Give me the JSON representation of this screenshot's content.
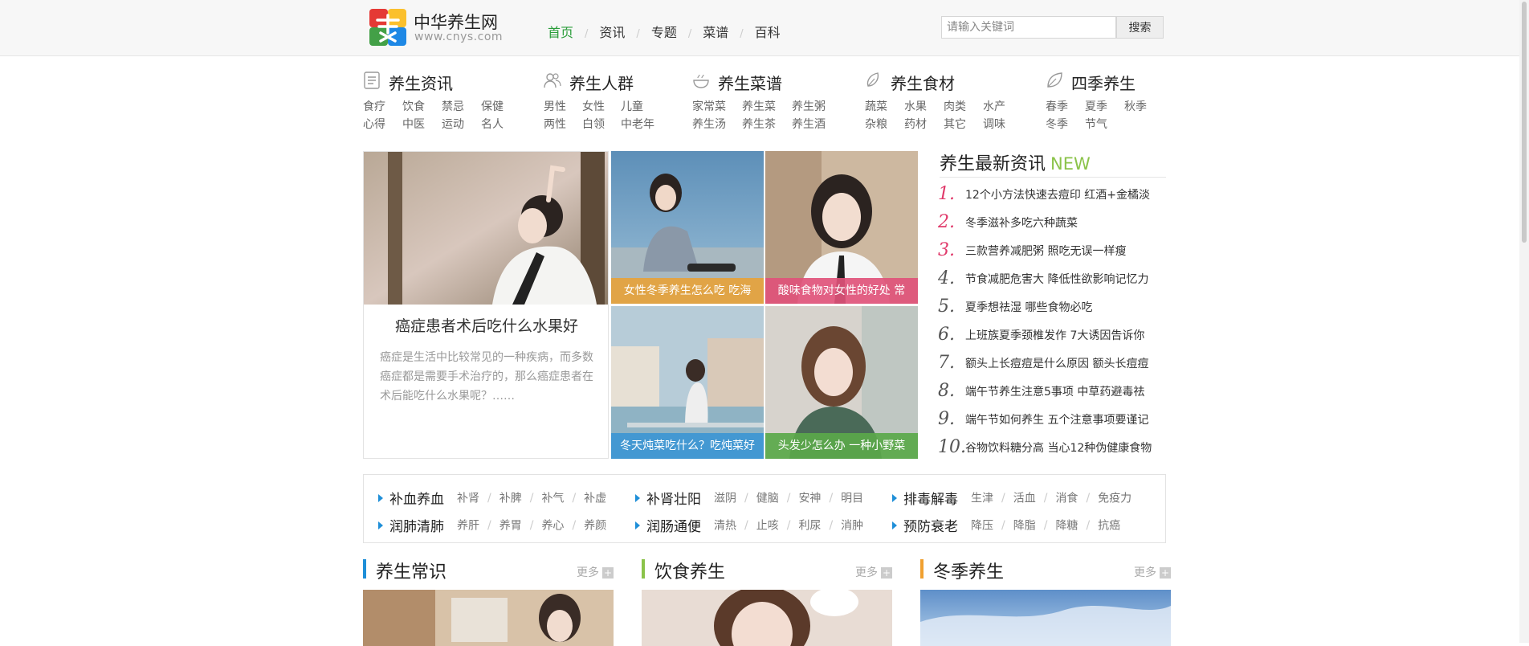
{
  "header": {
    "site_name": "中华养生网",
    "site_url": "www.cnys.com",
    "nav": [
      "首页",
      "资讯",
      "专题",
      "菜谱",
      "百科"
    ],
    "nav_sep": "/",
    "search": {
      "placeholder": "请输入关键词",
      "button": "搜索"
    }
  },
  "categories": [
    {
      "title": "养生资讯",
      "icon": "document-icon",
      "rows": [
        [
          "食疗",
          "饮食",
          "禁忌",
          "保健"
        ],
        [
          "心得",
          "中医",
          "运动",
          "名人"
        ]
      ]
    },
    {
      "title": "养生人群",
      "icon": "people-icon",
      "rows": [
        [
          "男性",
          "女性",
          "儿童"
        ],
        [
          "两性",
          "白领",
          "中老年"
        ]
      ]
    },
    {
      "title": "养生菜谱",
      "icon": "bowl-icon",
      "rows": [
        [
          "家常菜",
          "养生菜",
          "养生粥"
        ],
        [
          "养生汤",
          "养生茶",
          "养生酒"
        ]
      ]
    },
    {
      "title": "养生食材",
      "icon": "vegetable-icon",
      "rows": [
        [
          "蔬菜",
          "水果",
          "肉类",
          "水产"
        ],
        [
          "杂粮",
          "药材",
          "其它",
          "调味"
        ]
      ]
    },
    {
      "title": "四季养生",
      "icon": "leaf-icon",
      "rows": [
        [
          "春季",
          "夏季",
          "秋季"
        ],
        [
          "冬季",
          "节气"
        ]
      ]
    }
  ],
  "feature": {
    "title": "癌症患者术后吃什么水果好",
    "desc": "癌症是生活中比较常见的一种疾病，而多数癌症都是需要手术治疗的，那么癌症患者在术后能吃什么水果呢？……"
  },
  "tiles": [
    {
      "caption": "女性冬季养生怎么吃 吃海",
      "color": "#e6a23c"
    },
    {
      "caption": "酸味食物对女性的好处 常",
      "color": "#e0527a"
    },
    {
      "caption": "冬天炖菜吃什么？吃炖菜好",
      "color": "#3d96d3"
    },
    {
      "caption": "头发少怎么办 一种小野菜",
      "color": "#5aa84a"
    }
  ],
  "news": {
    "title": "养生最新资讯",
    "badge": "NEW",
    "items": [
      {
        "num": "1.",
        "text": "12个小方法快速去痘印 红酒+金橘淡"
      },
      {
        "num": "2.",
        "text": "冬季滋补多吃六种蔬菜"
      },
      {
        "num": "3.",
        "text": "三款营养减肥粥 照吃无误一样瘦"
      },
      {
        "num": "4.",
        "text": "节食减肥危害大 降低性欲影响记忆力"
      },
      {
        "num": "5.",
        "text": "夏季想祛湿 哪些食物必吃"
      },
      {
        "num": "6.",
        "text": "上班族夏季颈椎发作 7大诱因告诉你"
      },
      {
        "num": "7.",
        "text": "额头上长痘痘是什么原因 额头长痘痘"
      },
      {
        "num": "8.",
        "text": "端午节养生注意5事项 中草药避毒祛"
      },
      {
        "num": "9.",
        "text": "端午节如何养生 五个注意事项要谨记"
      },
      {
        "num": "10.",
        "text": "谷物饮料糖分高 当心12种伪健康食物"
      }
    ]
  },
  "tags": [
    {
      "name": "补血养血",
      "links": [
        "补肾",
        "补脾",
        "补气",
        "补虚"
      ]
    },
    {
      "name": "补肾壮阳",
      "links": [
        "滋阴",
        "健脑",
        "安神",
        "明目"
      ]
    },
    {
      "name": "排毒解毒",
      "links": [
        "生津",
        "活血",
        "消食",
        "免疫力"
      ]
    },
    {
      "name": "润肺清肺",
      "links": [
        "养肝",
        "养胃",
        "养心",
        "养颜"
      ]
    },
    {
      "name": "润肠通便",
      "links": [
        "清热",
        "止咳",
        "利尿",
        "消肿"
      ]
    },
    {
      "name": "预防衰老",
      "links": [
        "降压",
        "降脂",
        "降糖",
        "抗癌"
      ]
    }
  ],
  "sections": [
    {
      "title": "养生常识",
      "more": "更多",
      "accent": "#1f8fd8"
    },
    {
      "title": "饮食养生",
      "more": "更多",
      "accent": "#8bc34a"
    },
    {
      "title": "冬季养生",
      "more": "更多",
      "accent": "#f0a030"
    }
  ],
  "colors": {
    "nav_active": "#2a9d3a",
    "hot_number": "#e03a6b",
    "new_badge": "#8bc34a"
  }
}
